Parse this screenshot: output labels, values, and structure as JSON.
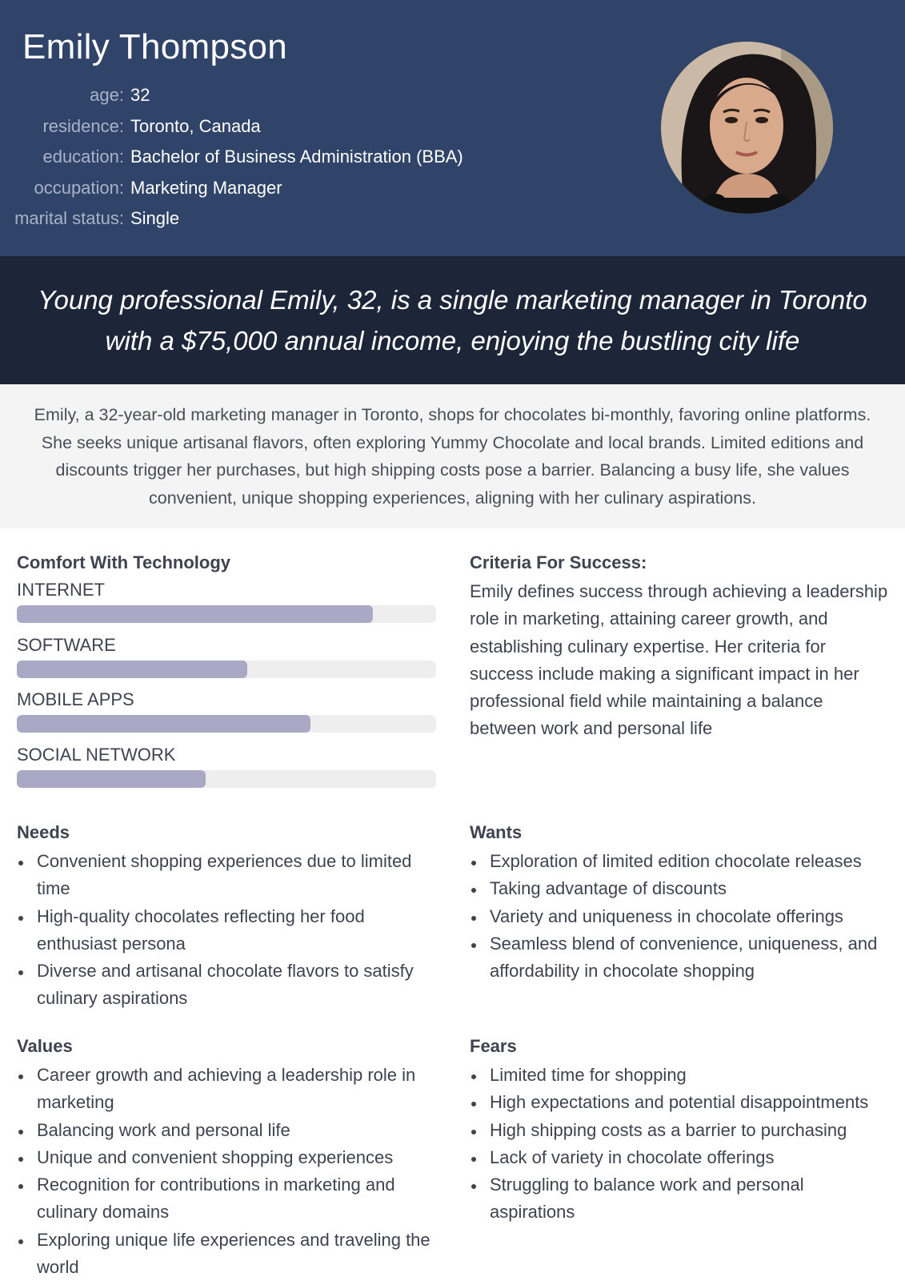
{
  "persona": {
    "name": "Emily Thompson",
    "attributes": [
      {
        "label": "age:",
        "value": "32"
      },
      {
        "label": "residence:",
        "value": "Toronto, Canada"
      },
      {
        "label": "education:",
        "value": "Bachelor of Business Administration (BBA)"
      },
      {
        "label": "occupation:",
        "value": "Marketing Manager"
      },
      {
        "label": "marital status:",
        "value": "Single"
      }
    ]
  },
  "quote": "Young professional Emily, 32, is a single marketing manager in Toronto with a $75,000 annual income, enjoying the bustling city life",
  "summary": "Emily, a 32-year-old marketing manager in Toronto, shops for chocolates bi-monthly, favoring online platforms. She seeks unique artisanal flavors, often exploring Yummy Chocolate and local brands. Limited editions and discounts trigger her purchases, but high shipping costs pose a barrier. Balancing a busy life, she values convenient, unique shopping experiences, aligning with her culinary aspirations.",
  "technology": {
    "title": "Comfort With Technology",
    "items": [
      {
        "label": "INTERNET",
        "level": 0.85
      },
      {
        "label": "SOFTWARE",
        "level": 0.55
      },
      {
        "label": "MOBILE APPS",
        "level": 0.7
      },
      {
        "label": "SOCIAL NETWORK",
        "level": 0.45
      }
    ],
    "bar_color": "#a9a9c6",
    "track_color": "#eeeeee"
  },
  "criteria": {
    "title": "Criteria For Success:",
    "text": "Emily defines success through achieving a leadership role in marketing, attaining career growth, and establishing culinary expertise. Her criteria for success include making a significant impact in her professional field while maintaining a balance between work and personal life"
  },
  "needs": {
    "title": "Needs",
    "items": [
      "Convenient shopping experiences due to limited time",
      "High-quality chocolates reflecting her food enthusiast persona",
      "Diverse and artisanal chocolate flavors to satisfy culinary aspirations"
    ]
  },
  "wants": {
    "title": "Wants",
    "items": [
      "Exploration of limited edition chocolate releases",
      "Taking advantage of discounts",
      "Variety and uniqueness in chocolate offerings",
      "Seamless blend of convenience, uniqueness, and affordability in chocolate shopping"
    ]
  },
  "values": {
    "title": "Values",
    "items": [
      "Career growth and achieving a leadership role in marketing",
      "Balancing work and personal life",
      "Unique and convenient shopping experiences",
      "Recognition for contributions in marketing and culinary domains",
      "Exploring unique life experiences and traveling the world"
    ]
  },
  "fears": {
    "title": "Fears",
    "items": [
      "Limited time for shopping",
      "High expectations and potential disappointments",
      "High shipping costs as a barrier to purchasing",
      "Lack of variety in chocolate offerings",
      "Struggling to balance work and personal aspirations"
    ]
  },
  "colors": {
    "header_bg": "#2f4468",
    "quote_bg": "#1c2638",
    "summary_bg": "#f4f4f4",
    "label_color": "#a8b3c8"
  }
}
